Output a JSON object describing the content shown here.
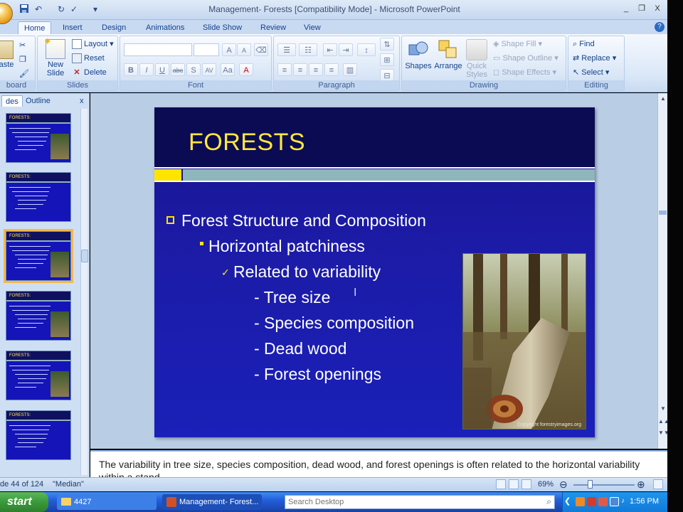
{
  "window": {
    "title": "Management- Forests [Compatibility Mode] - Microsoft PowerPoint",
    "minimize": "_",
    "restore": "❐",
    "close": "X"
  },
  "tabs": [
    "Home",
    "Insert",
    "Design",
    "Animations",
    "Slide Show",
    "Review",
    "View"
  ],
  "ribbon": {
    "clipboard": {
      "paste": "aste",
      "label": "board"
    },
    "slides": {
      "new_slide": "New",
      "new_slide2": "Slide",
      "layout": "Layout",
      "reset": "Reset",
      "delete": "Delete",
      "label": "Slides"
    },
    "font": {
      "label": "Font",
      "bold": "B",
      "italic": "I",
      "underline": "U",
      "strike": "abc",
      "shadow": "S",
      "spacing": "AV",
      "case": "Aa",
      "grow": "A",
      "shrink": "A"
    },
    "paragraph": {
      "label": "Paragraph"
    },
    "drawing": {
      "shapes": "Shapes",
      "arrange": "Arrange",
      "quick_styles": "Quick",
      "quick_styles2": "Styles",
      "shape_fill": "Shape Fill",
      "shape_outline": "Shape Outline",
      "shape_effects": "Shape Effects",
      "label": "Drawing"
    },
    "editing": {
      "find": "Find",
      "replace": "Replace",
      "select": "Select",
      "label": "Editing"
    }
  },
  "panel": {
    "tab_slides": "des",
    "tab_outline": "Outline",
    "close": "x"
  },
  "thumbnails": [
    {
      "title": "FORESTS:",
      "selected": false
    },
    {
      "title": "FORESTS:",
      "selected": false
    },
    {
      "title": "FORESTS:",
      "selected": true
    },
    {
      "title": "FORESTS:",
      "selected": false
    },
    {
      "title": "FORESTS:",
      "selected": false
    },
    {
      "title": "FORESTS:",
      "selected": false
    }
  ],
  "slide": {
    "title": "FORESTS",
    "bullet1": "Forest Structure and Composition",
    "bullet2": "Horizontal patchiness",
    "bullet3": "Related to variability",
    "items": [
      "- Tree size",
      "- Species composition",
      "- Dead wood",
      "- Forest openings"
    ],
    "photo_credit": "Copyright forestryimages.org"
  },
  "notes": "The variability in tree size, species composition, dead wood, and forest openings is often related to the horizontal variability within a stand.",
  "status": {
    "slide": "de 44 of 124",
    "theme": "\"Median\"",
    "zoom": "69%",
    "zoom_level": 0.69
  },
  "taskbar": {
    "start": "start",
    "task1": "4427",
    "task2": "Management- Forest...",
    "search_placeholder": "Search Desktop",
    "clock": "1:56 PM"
  },
  "colors": {
    "slide_bg": "#1a1ba6",
    "title_color": "#ffe83a",
    "accent_yellow": "#ffe400",
    "accent_teal": "#8fb5bd",
    "ribbon_bg": "#dbe8f8"
  }
}
